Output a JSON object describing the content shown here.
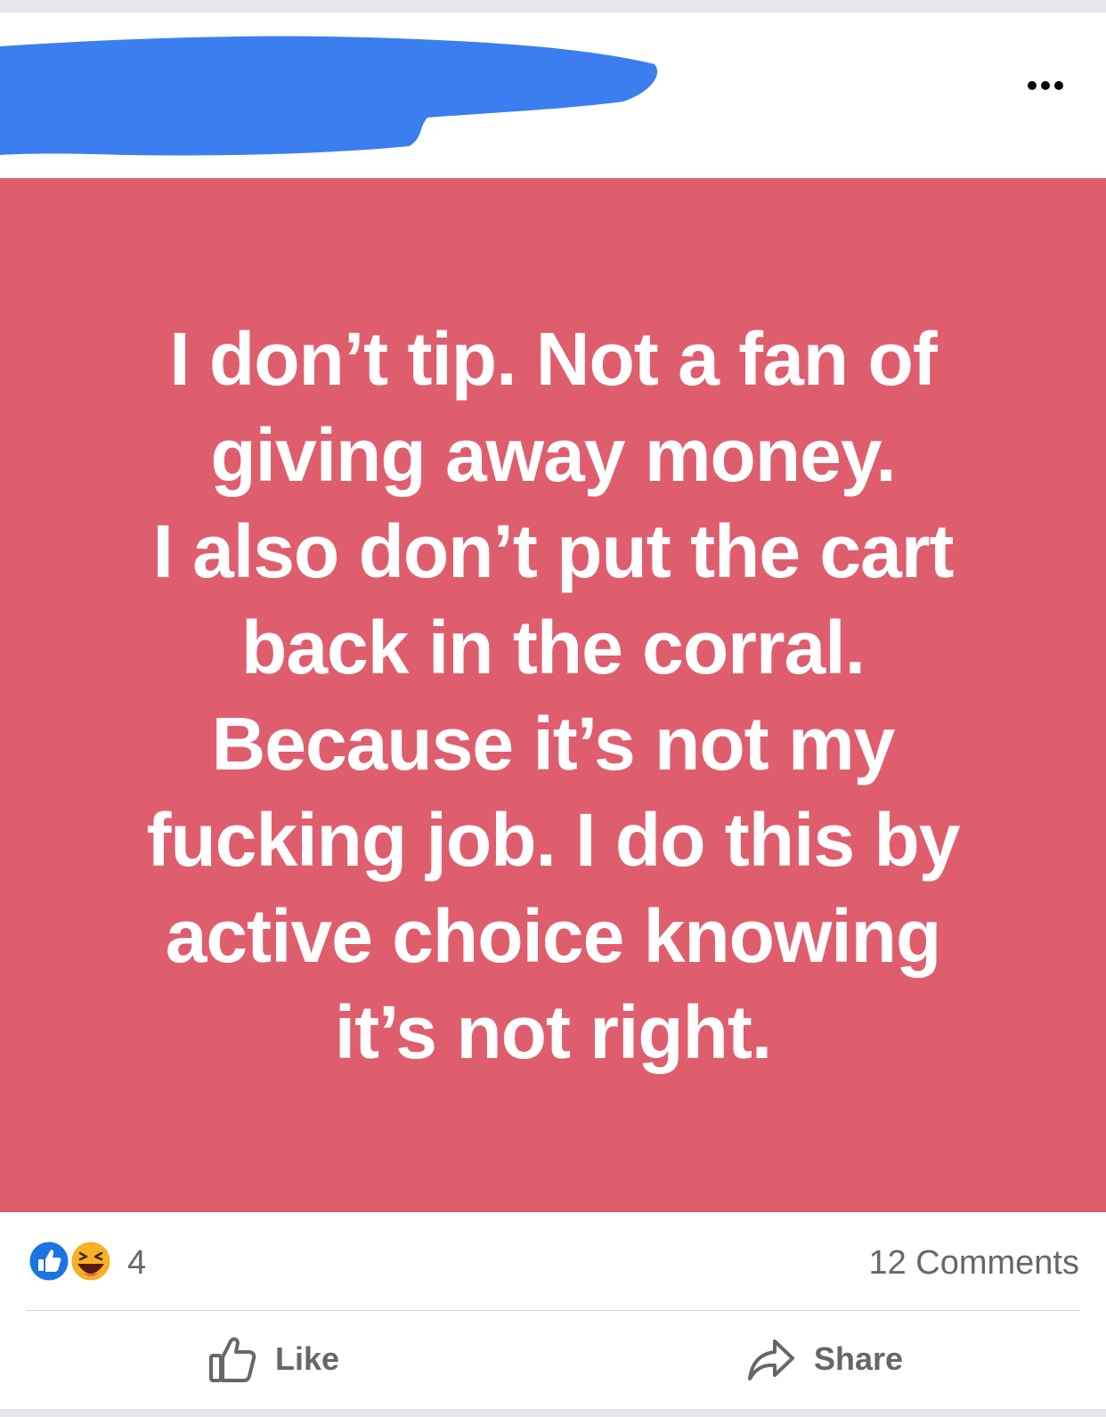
{
  "post": {
    "background_color": "#df5e6e",
    "text": "I don’t tip. Not a fan of\ngiving away money.\nI also don’t put the cart\nback in the corral.\nBecause it’s not my\nfucking job. I do this by\nactive choice knowing\nit’s not right.",
    "author_redaction_color": "#3b7ef0",
    "menu_icon": "more-dots-icon"
  },
  "stats": {
    "reaction_icons": [
      "like-reaction-icon",
      "haha-reaction-icon"
    ],
    "reaction_count": "4",
    "comments": "12 Comments"
  },
  "actions": {
    "like_label": "Like",
    "like_icon": "thumbs-up-icon",
    "share_label": "Share",
    "share_icon": "share-arrow-icon"
  }
}
